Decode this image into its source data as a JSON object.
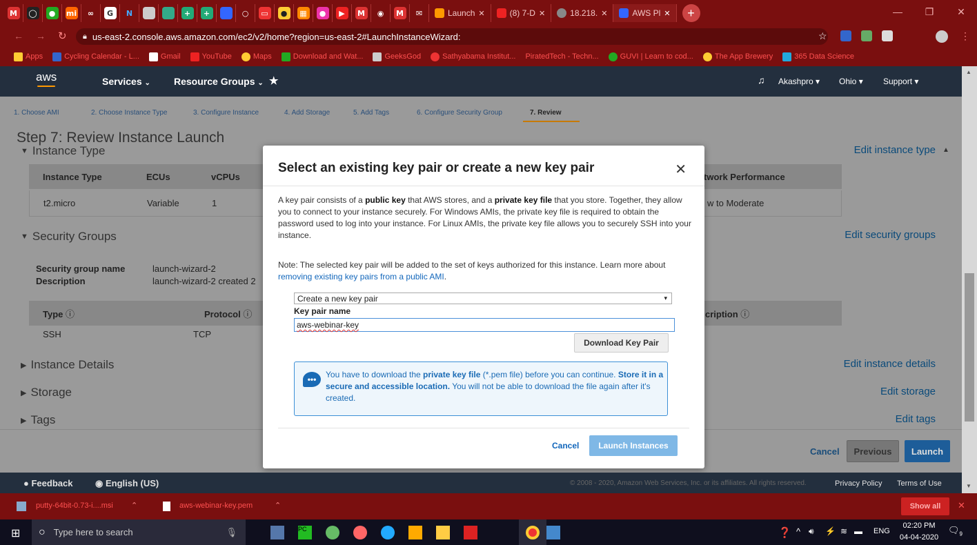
{
  "browser": {
    "tabs": [
      {
        "label": "Launch"
      },
      {
        "label": "(8) 7-D"
      },
      {
        "label": "18.218."
      },
      {
        "label": "AWS Pl"
      }
    ],
    "url": "us-east-2.console.aws.amazon.com/ec2/v2/home?region=us-east-2#LaunchInstanceWizard:",
    "bookmarks": [
      "Apps",
      "Cycling Calendar - L...",
      "Gmail",
      "YouTube",
      "Maps",
      "Download and Wat...",
      "GeeksGod",
      "Sathyabama Institut...",
      "PiratedTech - Techn...",
      "GUVI | Learn to cod...",
      "The App Brewery",
      "365 Data Science"
    ]
  },
  "aws_nav": {
    "logo": "aws",
    "services": "Services",
    "resource_groups": "Resource Groups",
    "user": "Akashpro",
    "region": "Ohio",
    "support": "Support"
  },
  "wizard": {
    "steps": [
      "1. Choose AMI",
      "2. Choose Instance Type",
      "3. Configure Instance",
      "4. Add Storage",
      "5. Add Tags",
      "6. Configure Security Group",
      "7. Review"
    ],
    "title": "Step 7: Review Instance Launch",
    "instance_type_section": "Instance Type",
    "edit_instance_type": "Edit instance type",
    "instance_table": {
      "headers": [
        "Instance Type",
        "ECUs",
        "vCPUs",
        "twork Performance"
      ],
      "row": [
        "t2.micro",
        "Variable",
        "1",
        "w to Moderate"
      ]
    },
    "security_groups_section": "Security Groups",
    "edit_security_groups": "Edit security groups",
    "sg_name_label": "Security group name",
    "sg_name_value": "launch-wizard-2",
    "sg_desc_label": "Description",
    "sg_desc_value": "launch-wizard-2 created 2",
    "sg_table": {
      "headers": [
        "Type",
        "Protocol",
        "cription"
      ],
      "row": [
        "SSH",
        "TCP"
      ]
    },
    "instance_details": "Instance Details",
    "edit_instance_details": "Edit instance details",
    "storage": "Storage",
    "edit_storage": "Edit storage",
    "tags": "Tags",
    "edit_tags": "Edit tags",
    "cancel": "Cancel",
    "previous": "Previous",
    "launch": "Launch"
  },
  "modal": {
    "title": "Select an existing key pair or create a new key pair",
    "p1_a": "A key pair consists of a ",
    "p1_b": "public key",
    "p1_c": " that AWS stores, and a ",
    "p1_d": "private key file",
    "p1_e": " that you store. Together, they allow you to connect to your instance securely. For Windows AMIs, the private key file is required to obtain the password used to log into your instance. For Linux AMIs, the private key file allows you to securely SSH into your instance.",
    "p2_a": "Note: The selected key pair will be added to the set of keys authorized for this instance. Learn more about ",
    "p2_link": "removing existing key pairs from a public AMI",
    "p2_b": ".",
    "select_value": "Create a new key pair",
    "key_pair_label": "Key pair name",
    "key_pair_value": "aws-webinar-key",
    "download_button": "Download Key Pair",
    "info_a": "You have to download the ",
    "info_b": "private key file",
    "info_c": " (*.pem file) before you can continue. ",
    "info_d": "Store it in a secure and accessible location.",
    "info_e": " You will not be able to download the file again after it's created.",
    "cancel": "Cancel",
    "launch": "Launch Instances"
  },
  "footer": {
    "feedback": "Feedback",
    "language": "English (US)",
    "copyright": "© 2008 - 2020, Amazon Web Services, Inc. or its affiliates. All rights reserved.",
    "privacy": "Privacy Policy",
    "terms": "Terms of Use"
  },
  "downloads": {
    "item1": "putty-64bit-0.73-i....msi",
    "item2": "aws-webinar-key.pem",
    "show_all": "Show all"
  },
  "taskbar": {
    "search": "Type here to search",
    "lang": "ENG",
    "time": "02:20 PM",
    "date": "04-04-2020",
    "notif_count": "9"
  }
}
